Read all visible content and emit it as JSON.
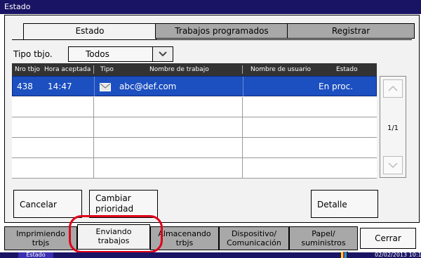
{
  "window": {
    "title": "Estado"
  },
  "tabs": [
    {
      "label": "Estado",
      "active": true
    },
    {
      "label": "Trabajos programados",
      "active": false
    },
    {
      "label": "Registrar",
      "active": false
    }
  ],
  "filter": {
    "label": "Tipo tbjo.",
    "value": "Todos"
  },
  "table": {
    "columns": [
      "Nro tbjo",
      "Hora aceptada",
      "Tipo",
      "Nombre de trabajo",
      "Nombre de usuario",
      "Estado"
    ],
    "rows": [
      {
        "nro": "438",
        "hora": "14:47",
        "tipo_icon": "email-icon",
        "nombre": "abc@def.com",
        "usuario": "",
        "estado": "En proc.",
        "selected": true
      }
    ],
    "page": "1/1"
  },
  "actions": {
    "cancelar": "Cancelar",
    "cambiar_line1": "Cambiar",
    "cambiar_line2": "prioridad",
    "detalle": "Detalle"
  },
  "nav": {
    "imprimiendo_1": "Imprimiendo",
    "imprimiendo_2": "trbjs",
    "enviando_1": "Enviando",
    "enviando_2": "trabajos",
    "almacenando_1": "Almacenando",
    "almacenando_2": "trbjs",
    "dispositivo_1": "Dispositivo/",
    "dispositivo_2": "Comunicación",
    "papel_1": "Papel/",
    "papel_2": "suministros",
    "cerrar": "Cerrar"
  },
  "status": {
    "label": "Estado",
    "datetime": "02/02/2013 10:1"
  },
  "colors": {
    "titlebar": "#1a1464",
    "selected_row": "#1c4fbf",
    "highlight": "#e0001b"
  }
}
